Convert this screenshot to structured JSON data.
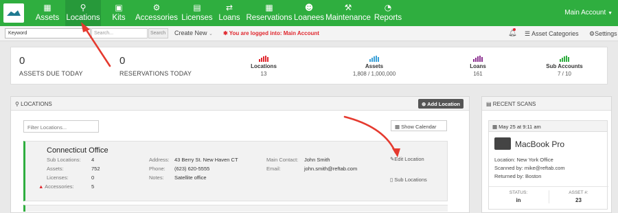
{
  "nav": {
    "items": [
      {
        "label": "Assets",
        "icon": "grid-icon"
      },
      {
        "label": "Locations",
        "icon": "map-pin-icon"
      },
      {
        "label": "Kits",
        "icon": "briefcase-icon"
      },
      {
        "label": "Accessories",
        "icon": "accessories-icon"
      },
      {
        "label": "Licenses",
        "icon": "license-icon"
      },
      {
        "label": "Loans",
        "icon": "loans-icon"
      },
      {
        "label": "Reservations",
        "icon": "calendar-icon"
      },
      {
        "label": "Loanees",
        "icon": "people-icon"
      },
      {
        "label": "Maintenance",
        "icon": "wrench-icon"
      },
      {
        "label": "Reports",
        "icon": "pie-chart-icon"
      }
    ],
    "active": "Locations",
    "account": "Main Account"
  },
  "subbar": {
    "keyword": "Keyword",
    "search_placeholder": "Search...",
    "search_button": "Search",
    "create_new": "Create New",
    "logged_in": "✱ You are logged into: Main Account",
    "asset_categories": "Asset Categories",
    "settings": "Settings"
  },
  "stats": {
    "assets_due": {
      "value": "0",
      "label": "ASSETS DUE TODAY"
    },
    "reservations": {
      "value": "0",
      "label": "RESERVATIONS TODAY"
    },
    "mini": [
      {
        "title": "Locations",
        "value": "13",
        "color": "#e0262d"
      },
      {
        "title": "Assets",
        "value": "1,808 / 1,000,000",
        "color": "#3aa0d8"
      },
      {
        "title": "Loans",
        "value": "161",
        "color": "#8b2f8f"
      },
      {
        "title": "Sub Accounts",
        "value": "7 / 10",
        "color": "#2fae3f"
      }
    ]
  },
  "locations_panel": {
    "title": "LOCATIONS",
    "add_button": "Add Location",
    "filter_placeholder": "Filter Locations...",
    "show_calendar": "Show Calendar",
    "card": {
      "name": "Connecticut Office",
      "counts": [
        {
          "k": "Sub Locations:",
          "v": "4"
        },
        {
          "k": "Assets:",
          "v": "752"
        },
        {
          "k": "Licenses:",
          "v": "0"
        },
        {
          "k": "Accessories:",
          "v": "5",
          "warning": true
        }
      ],
      "info": [
        {
          "k": "Address:",
          "v": "43 Berry St. New Haven CT"
        },
        {
          "k": "Phone:",
          "v": "(623) 620-5555"
        },
        {
          "k": "Notes:",
          "v": "Satellite office"
        }
      ],
      "contact": [
        {
          "k": "Main Contact:",
          "v": "John Smith"
        },
        {
          "k": "Email:",
          "v": "john.smith@reftab.com"
        }
      ],
      "edit_location": "Edit Location",
      "sub_locations": "Sub Locations"
    }
  },
  "recent_scans": {
    "title": "RECENT SCANS",
    "date": "May 25 at 9:11 am",
    "item_name": "MacBook Pro",
    "location": "Location: New York Office",
    "scanned_by": "Scanned by: mike@reftab.com",
    "returned_by": "Returned by: Boston",
    "status_label": "STATUS:",
    "status_value": "in",
    "asset_num_label": "ASSET #:",
    "asset_num_value": "23"
  },
  "annotation_color": "#e53a2f"
}
